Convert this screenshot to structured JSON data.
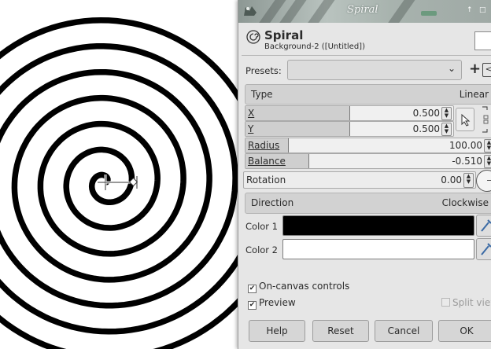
{
  "dialog": {
    "window_title": "Spiral",
    "plugin_name": "Spiral",
    "layer_name": "Background-2 ([Untitled])"
  },
  "presets": {
    "label": "Presets:",
    "value": ""
  },
  "type": {
    "label": "Type",
    "value": "Linear"
  },
  "params": {
    "x": {
      "label": "X",
      "value": "0.500",
      "fill": 0.5
    },
    "y": {
      "label": "Y",
      "value": "0.500",
      "fill": 0.5
    },
    "radius": {
      "label": "Radius",
      "value": "100.00",
      "fill": 0.17
    },
    "balance": {
      "label": "Balance",
      "value": "-0.510",
      "fill": 0.25
    },
    "rotation": {
      "label": "Rotation",
      "value": "0.00"
    }
  },
  "direction": {
    "label": "Direction",
    "value": "Clockwise"
  },
  "colors": {
    "color1": {
      "label": "Color 1",
      "hex": "#000000"
    },
    "color2": {
      "label": "Color 2",
      "hex": "#ffffff"
    }
  },
  "options": {
    "on_canvas": {
      "label": "On-canvas controls",
      "checked": true
    },
    "preview": {
      "label": "Preview",
      "checked": true
    },
    "split_view": {
      "label": "Split view",
      "checked": false
    }
  },
  "buttons": {
    "help": "Help",
    "reset": "Reset",
    "cancel": "Cancel",
    "ok": "OK"
  },
  "icons": {
    "app": "gimp-icon",
    "plugin": "spiral-icon",
    "add": "plus-icon",
    "pick": "pointer-icon",
    "chain": "chain-link-icon",
    "dropper": "eyedropper-icon",
    "dropdown": "chevron-down-icon"
  },
  "canvas": {
    "spiral_color": "#000000",
    "background": "#ffffff"
  }
}
